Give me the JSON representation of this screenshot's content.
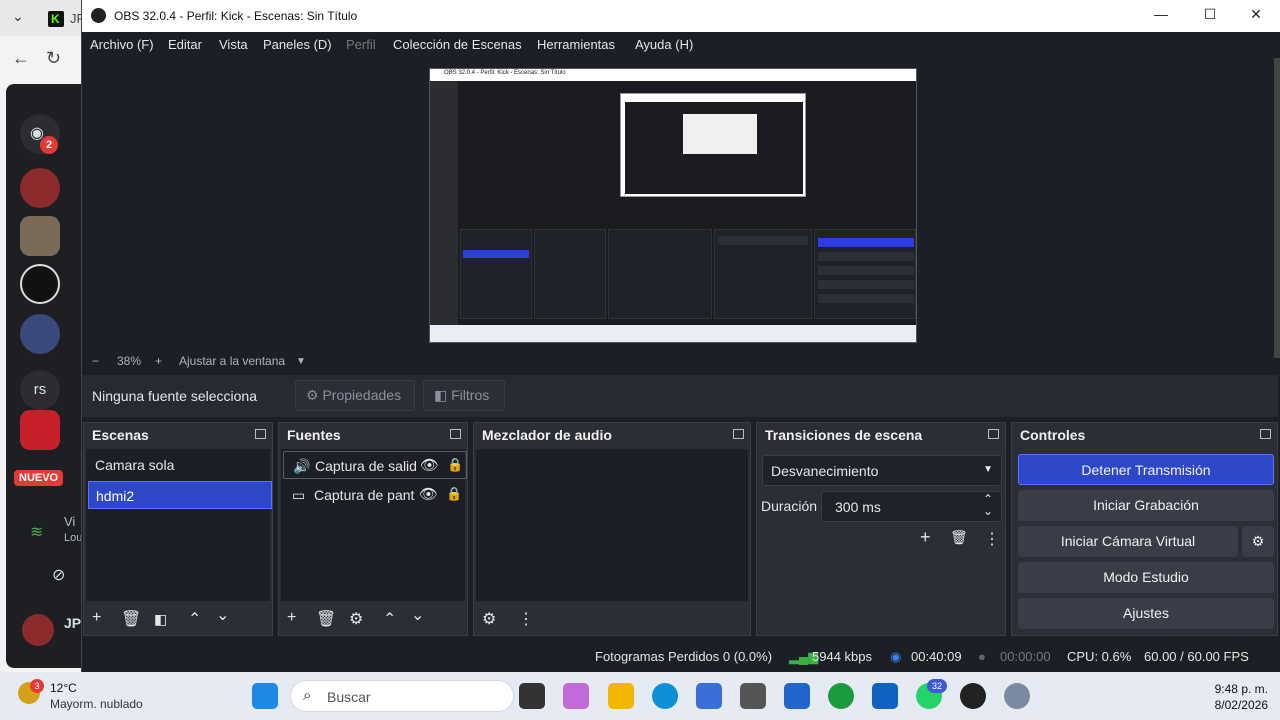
{
  "background_browser": {
    "tab_label": "JP",
    "discord_badge": "2",
    "server_label": "rs",
    "new_badge": "NUEVO",
    "channel_label": "Vi",
    "channel_sub": "Lou",
    "user_label": "JP"
  },
  "window": {
    "title": "OBS 32.0.4 - Perfil: Kick - Escenas: Sin Título",
    "minimize": "—",
    "maximize": "☐",
    "close": "✕"
  },
  "menu": {
    "archivo": "Archivo (F)",
    "editar": "Editar",
    "vista": "Vista",
    "paneles": "Paneles (D)",
    "perfil": "Perfil",
    "coleccion": "Colección de Escenas",
    "herramientas": "Herramientas",
    "ayuda": "Ayuda (H)"
  },
  "preview": {
    "mini_title": "OBS 32.0.4 - Perfil: Kick - Escenas: Sin Título"
  },
  "zoom": {
    "minus": "−",
    "value": "38%",
    "plus": "+",
    "fit_label": "Ajustar a la ventana"
  },
  "source_bar": {
    "no_source": "Ninguna fuente selecciona",
    "properties": "Propiedades",
    "filters": "Filtros"
  },
  "scenes": {
    "title": "Escenas",
    "items": [
      "Camara sola",
      "hdmi2"
    ],
    "selected_index": 1
  },
  "sources": {
    "title": "Fuentes",
    "items": [
      {
        "name": "Captura de salid",
        "icon": "speaker-icon"
      },
      {
        "name": "Captura de pant",
        "icon": "monitor-icon"
      }
    ]
  },
  "mixer": {
    "title": "Mezclador de audio"
  },
  "transitions": {
    "title": "Transiciones de escena",
    "selected": "Desvanecimiento",
    "duration_label": "Duración",
    "duration_value": "300 ms"
  },
  "controls": {
    "title": "Controles",
    "stop_stream": "Detener Transmisión",
    "start_recording": "Iniciar Grabación",
    "virtual_cam": "Iniciar Cámara Virtual",
    "studio_mode": "Modo Estudio",
    "settings": "Ajustes"
  },
  "status": {
    "dropped_frames": "Fotogramas Perdidos 0 (0.0%)",
    "bitrate": "5944 kbps",
    "stream_time": "00:40:09",
    "rec_time": "00:00:00",
    "cpu": "CPU: 0.6%",
    "fps": "60.00 / 60.00 FPS"
  },
  "taskbar": {
    "weather_badge": "3",
    "temperature": "12°C",
    "weather_desc": "Mayorm. nublado",
    "search_placeholder": "Buscar",
    "whatsapp_badge": "32",
    "time": "9:48 p. m.",
    "date": "8/02/2026"
  },
  "colors": {
    "obs_bg": "#1d1f26",
    "dock_bg": "#2b2e37",
    "accent": "#2d47c6",
    "bitrate_green": "#3cb043",
    "stream_blue": "#3b82f6"
  }
}
